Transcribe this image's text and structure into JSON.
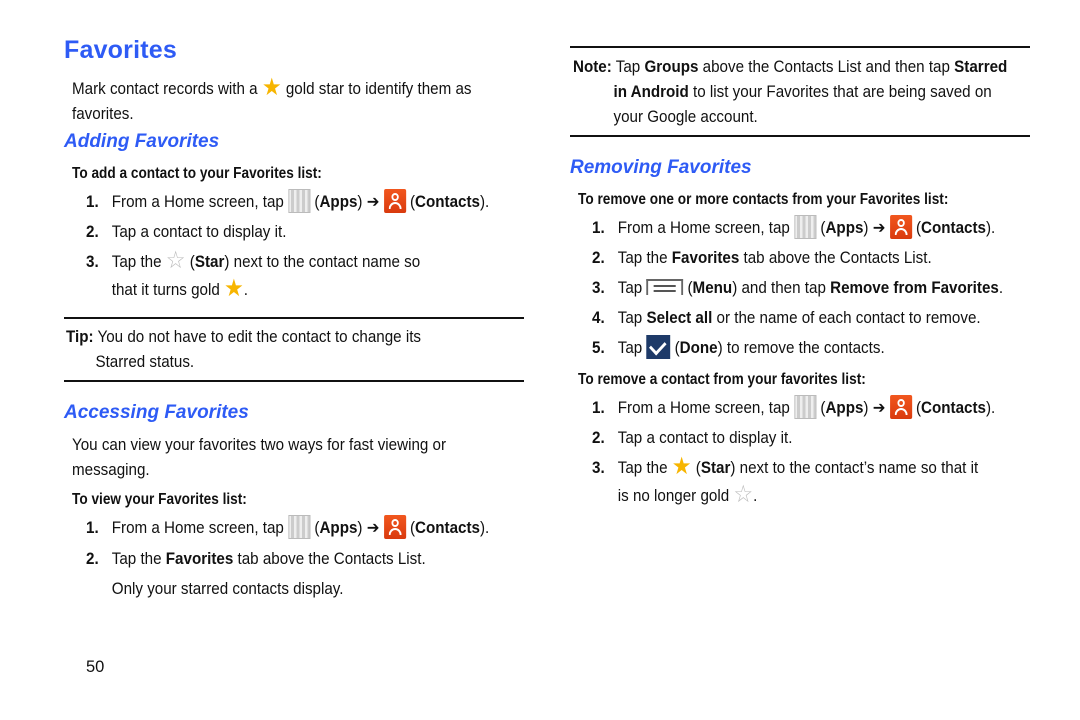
{
  "page": {
    "title": "Favorites",
    "intro": {
      "before_icon": "Mark contact records with a",
      "icon": "gold-star-icon",
      "after_icon": "gold star to identify them as",
      "line2": "favorites."
    },
    "page_number": "50"
  },
  "adding": {
    "heading": "Adding Favorites",
    "procedure_title": "To add a contact to your Favorites list:",
    "steps": [
      {
        "num": "1.",
        "text_a": "From a Home screen, tap",
        "apps": "Apps",
        "arrow": "➔",
        "contacts": "Contacts",
        "close": ")."
      },
      {
        "num": "2.",
        "text": "Tap a contact to display it."
      },
      {
        "num": "3.",
        "text_a": "Tap the",
        "star_label": "Star",
        "text_b": ") next to the contact name so",
        "line2": "that it turns gold",
        "end": "."
      }
    ]
  },
  "tip": {
    "label": "Tip:",
    "line1": "You do not have to edit the contact to change its",
    "line2": "Starred status."
  },
  "accessing": {
    "heading": "Accessing Favorites",
    "para_line1": "You can view your favorites two ways for fast viewing or",
    "para_line2": "messaging.",
    "procedure_title": "To view your Favorites list:",
    "steps": [
      {
        "num": "1.",
        "text_a": "From a Home screen, tap",
        "apps": "Apps",
        "arrow": "➔",
        "contacts": "Contacts",
        "close": ")."
      },
      {
        "num": "2.",
        "text_a": "Tap the",
        "bold": "Favorites",
        "text_b": "tab above the Contacts List.",
        "line2": "Only your starred contacts display."
      }
    ]
  },
  "note": {
    "label": "Note:",
    "l1_a": "Tap",
    "l1_bold1": "Groups",
    "l1_b": "above the Contacts List and then tap",
    "l1_bold2": "Starred",
    "l2_bold": "in Android",
    "l2_text": "to list your Favorites that are being saved on",
    "l3": "your Google account."
  },
  "removing": {
    "heading": "Removing Favorites",
    "procedure1_title": "To remove one or more contacts from your Favorites list:",
    "steps1": [
      {
        "num": "1.",
        "text_a": "From a Home screen, tap",
        "apps": "Apps",
        "arrow": "➔",
        "contacts": "Contacts",
        "close": ")."
      },
      {
        "num": "2.",
        "text_a": "Tap the",
        "bold": "Favorites",
        "text_b": "tab above the Contacts List."
      },
      {
        "num": "3.",
        "text_a": "Tap",
        "menu": "Menu",
        "text_b": ") and then tap",
        "bold": "Remove from Favorites",
        "end": "."
      },
      {
        "num": "4.",
        "text_a": "Tap",
        "bold": "Select all",
        "text_b": "or the name of each contact to remove."
      },
      {
        "num": "5.",
        "text_a": "Tap",
        "done": "Done",
        "text_b": ") to remove the contacts."
      }
    ],
    "procedure2_title": "To remove a contact from your favorites list:",
    "steps2": [
      {
        "num": "1.",
        "text_a": "From a Home screen, tap",
        "apps": "Apps",
        "arrow": "➔",
        "contacts": "Contacts",
        "close": ")."
      },
      {
        "num": "2.",
        "text": "Tap a contact to display it."
      },
      {
        "num": "3.",
        "text_a": "Tap the",
        "star_label": "Star",
        "text_b": ") next to the contact’s name so that it",
        "line2": "is no longer gold",
        "end": "."
      }
    ]
  },
  "colors": {
    "heading_blue": "#2E5BF5",
    "star_gold": "#F7B500",
    "contacts_orange": "#E8481A",
    "done_navy": "#1E3A68"
  }
}
